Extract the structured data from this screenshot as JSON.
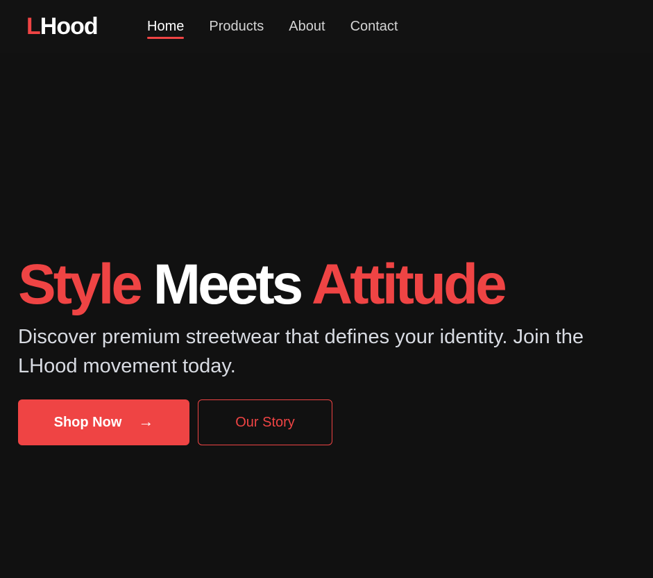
{
  "brand": {
    "logo_first": "L",
    "logo_rest": "Hood"
  },
  "nav": {
    "items": [
      {
        "label": "Home",
        "active": true
      },
      {
        "label": "Products",
        "active": false
      },
      {
        "label": "About",
        "active": false
      },
      {
        "label": "Contact",
        "active": false
      }
    ]
  },
  "hero": {
    "headline_1": "Style",
    "headline_2": "Meets",
    "headline_3": "Attitude",
    "subtitle": "Discover premium streetwear that defines your identity. Join the LHood movement today.",
    "primary_button": "Shop Now",
    "secondary_button": "Our Story"
  },
  "icons": {
    "primary_button_icon": "arrow-right-icon"
  },
  "colors": {
    "background": "#111111",
    "accent": "#ef4444",
    "text_primary": "#ffffff",
    "text_secondary": "#d8dbe2"
  }
}
